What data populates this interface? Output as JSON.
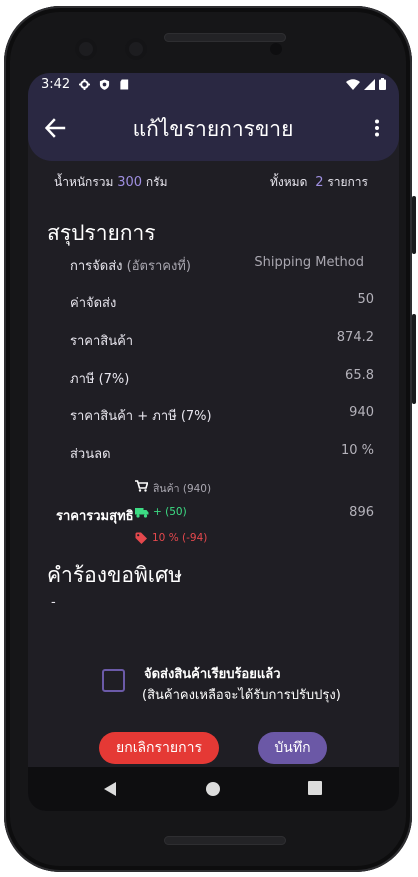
{
  "status": {
    "time": "3:42"
  },
  "appbar": {
    "title": "แก้ไขรายการขาย"
  },
  "summary_bar": {
    "weight_label": "น้ำหนักรวม",
    "weight_value": "300",
    "weight_unit": "กรัม",
    "total_label": "ทั้งหมด",
    "total_value": "2",
    "total_unit": "รายการ"
  },
  "section_summary": {
    "title": "สรุปรายการ"
  },
  "rows": {
    "shipping_method": {
      "label": "การจัดส่ง",
      "label_note": "(อัตราคงที่)",
      "value": "Shipping Method"
    },
    "shipping_cost": {
      "label": "ค่าจัดส่ง",
      "value": "50"
    },
    "product_price": {
      "label": "ราคาสินค้า",
      "value": "874.2"
    },
    "tax": {
      "label": "ภาษี (7%)",
      "value": "65.8"
    },
    "price_plus_tax": {
      "label": "ราคาสินค้า + ภาษี (7%)",
      "value": "940"
    },
    "discount": {
      "label": "ส่วนลด",
      "value": "10 %"
    }
  },
  "net": {
    "label": "ราคารวมสุทธิ",
    "value": "896",
    "products_line": "สินค้า (940)",
    "shipping_line": "+ (50)",
    "discount_line": "10 % (-94)"
  },
  "section_special": {
    "title": "คำร้องขอพิเศษ",
    "value": "-"
  },
  "delivered": {
    "title": "จัดส่งสินค้าเรียบร้อยแล้ว",
    "note": "(สินค้าคงเหลือจะได้รับการปรับปรุง)",
    "checked": false
  },
  "buttons": {
    "cancel": "ยกเลิกรายการ",
    "save": "บันทึก"
  },
  "colors": {
    "accent": "#9f8fe0",
    "appbar": "#2a2842",
    "background": "#1f1e24",
    "cancel": "#e53935",
    "save": "#6b58a6",
    "shipping_green": "#3ddc84",
    "discount_red": "#e5484d"
  },
  "icons": {
    "back": "arrow-left-icon",
    "menu": "more-vert-icon",
    "cart": "cart-icon",
    "truck": "truck-icon",
    "tag": "tag-icon",
    "checkbox": "checkbox-icon",
    "nav_back": "nav-back-icon",
    "nav_home": "nav-home-icon",
    "nav_recents": "nav-recents-icon"
  }
}
